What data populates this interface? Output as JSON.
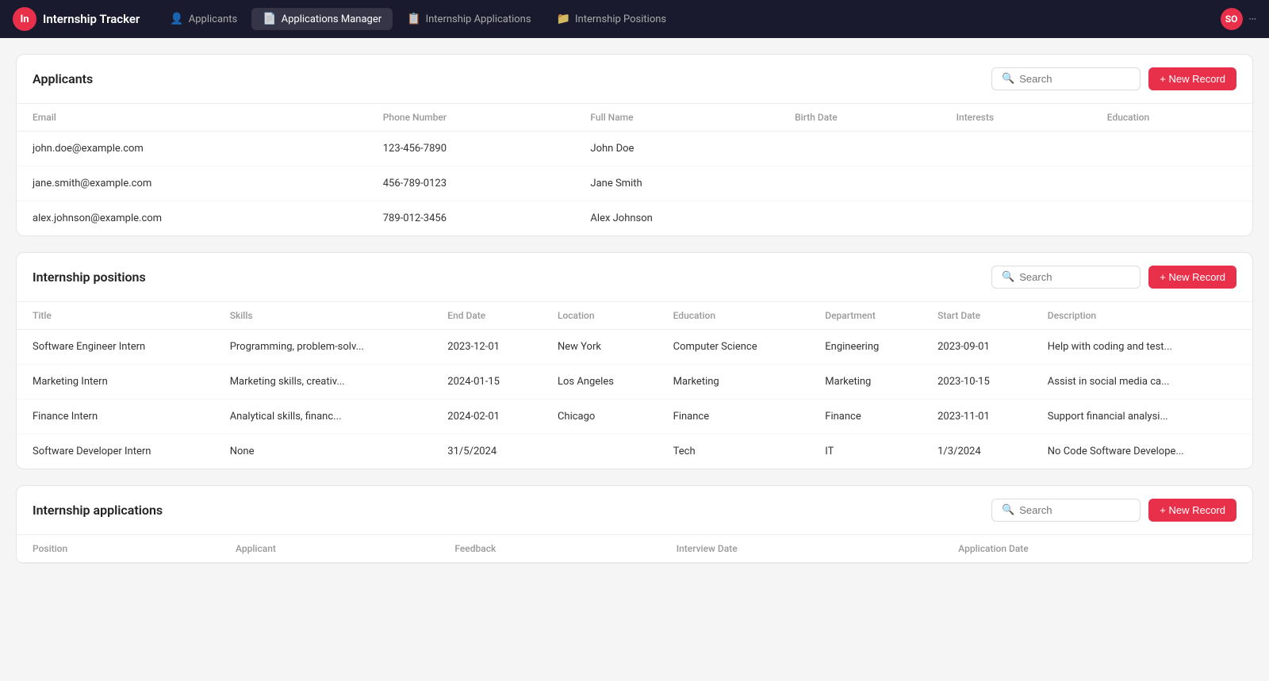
{
  "app": {
    "logo_initials": "In",
    "title": "Internship Tracker"
  },
  "nav": {
    "tabs": [
      {
        "id": "applicants",
        "icon": "👤",
        "label": "Applicants",
        "active": false
      },
      {
        "id": "applications-manager",
        "icon": "📄",
        "label": "Applications Manager",
        "active": true
      },
      {
        "id": "internship-applications",
        "icon": "📋",
        "label": "Internship Applications",
        "active": false
      },
      {
        "id": "internship-positions",
        "icon": "📁",
        "label": "Internship Positions",
        "active": false
      }
    ],
    "user_initials": "SO",
    "user_info": "···"
  },
  "sections": {
    "applicants": {
      "title": "Applicants",
      "search_placeholder": "Search",
      "new_record_label": "+ New Record",
      "columns": [
        "Email",
        "Phone Number",
        "Full Name",
        "Birth Date",
        "Interests",
        "Education"
      ],
      "rows": [
        {
          "email": "john.doe@example.com",
          "phone": "123-456-7890",
          "name": "John Doe",
          "birth_date": "",
          "interests": "",
          "education": ""
        },
        {
          "email": "jane.smith@example.com",
          "phone": "456-789-0123",
          "name": "Jane Smith",
          "birth_date": "",
          "interests": "",
          "education": ""
        },
        {
          "email": "alex.johnson@example.com",
          "phone": "789-012-3456",
          "name": "Alex Johnson",
          "birth_date": "",
          "interests": "",
          "education": ""
        }
      ]
    },
    "positions": {
      "title": "Internship positions",
      "search_placeholder": "Search",
      "new_record_label": "+ New Record",
      "columns": [
        "Title",
        "Skills",
        "End Date",
        "Location",
        "Education",
        "Department",
        "Start Date",
        "Description"
      ],
      "rows": [
        {
          "title": "Software Engineer Intern",
          "skills": "Programming, problem-solv...",
          "end_date": "2023-12-01",
          "location": "New York",
          "education": "Computer Science",
          "department": "Engineering",
          "start_date": "2023-09-01",
          "description": "Help with coding and test..."
        },
        {
          "title": "Marketing Intern",
          "skills": "Marketing skills, creativ...",
          "end_date": "2024-01-15",
          "location": "Los Angeles",
          "education": "Marketing",
          "department": "Marketing",
          "start_date": "2023-10-15",
          "description": "Assist in social media ca..."
        },
        {
          "title": "Finance Intern",
          "skills": "Analytical skills, financ...",
          "end_date": "2024-02-01",
          "location": "Chicago",
          "education": "Finance",
          "department": "Finance",
          "start_date": "2023-11-01",
          "description": "Support financial analysi..."
        },
        {
          "title": "Software Developer Intern",
          "skills": "None",
          "end_date": "31/5/2024",
          "location": "",
          "education": "Tech",
          "department": "IT",
          "start_date": "1/3/2024",
          "description": "No Code Software Develope..."
        }
      ]
    },
    "applications": {
      "title": "Internship applications",
      "search_placeholder": "Search",
      "new_record_label": "+ New Record",
      "columns": [
        "Position",
        "Applicant",
        "Feedback",
        "Interview Date",
        "Application Date"
      ],
      "rows": []
    }
  }
}
